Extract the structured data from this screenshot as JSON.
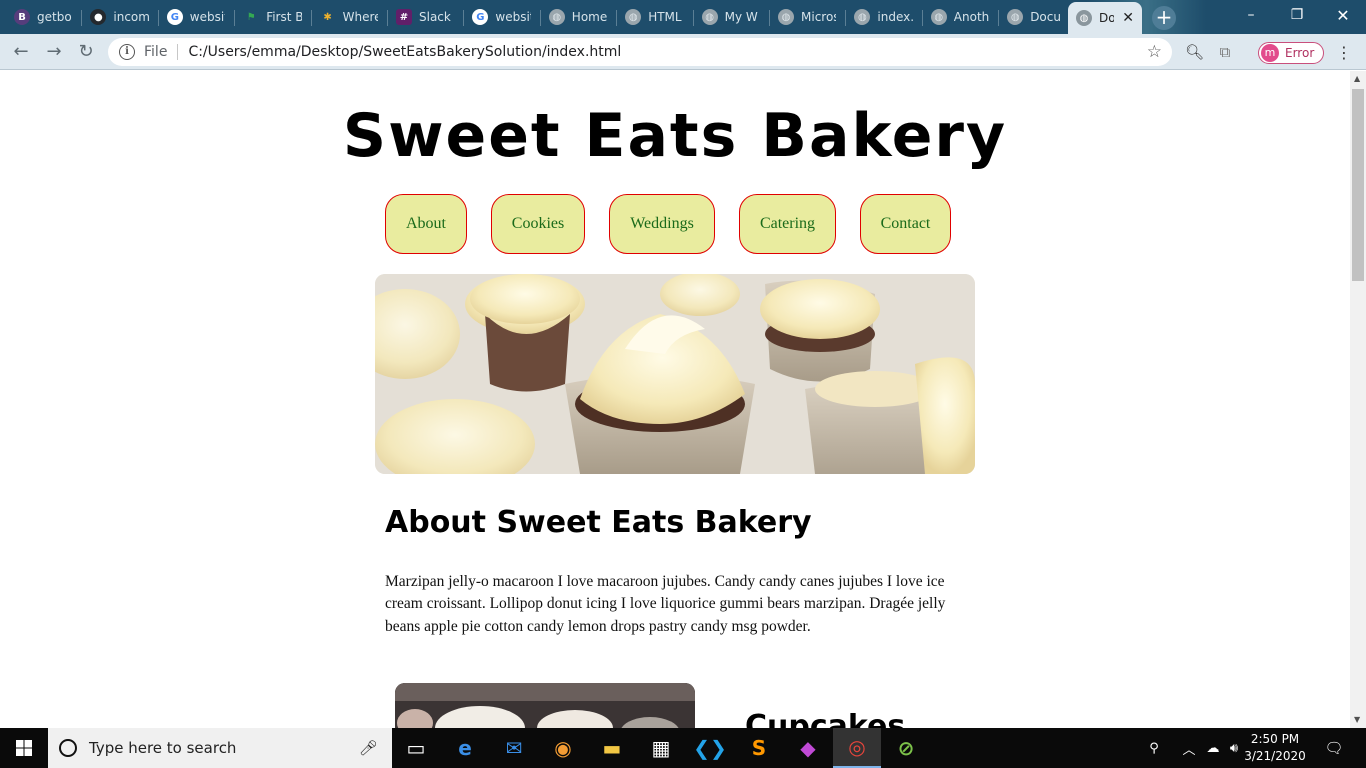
{
  "browser": {
    "tabs": [
      {
        "label": "getbo",
        "icon": "bootstrap-icon",
        "color": "#563d7c"
      },
      {
        "label": "incom",
        "icon": "github-icon",
        "color": "#24292e"
      },
      {
        "label": "websit",
        "icon": "google-icon",
        "color": "#ffffff"
      },
      {
        "label": "First B",
        "icon": "maps-icon",
        "color": "#34a853"
      },
      {
        "label": "Where",
        "icon": "slack-icon",
        "color": "#e01e5a"
      },
      {
        "label": "Slack |",
        "icon": "slack-app-icon",
        "color": "#611f69"
      },
      {
        "label": "websit",
        "icon": "google-icon",
        "color": "#ffffff"
      },
      {
        "label": "Home",
        "icon": "globe-icon",
        "color": "#9aa6ad"
      },
      {
        "label": "HTML",
        "icon": "globe-icon",
        "color": "#9aa6ad"
      },
      {
        "label": "My W",
        "icon": "globe-icon",
        "color": "#9aa6ad"
      },
      {
        "label": "Micros",
        "icon": "globe-icon",
        "color": "#9aa6ad"
      },
      {
        "label": "index.",
        "icon": "globe-icon",
        "color": "#9aa6ad"
      },
      {
        "label": "Anoth",
        "icon": "globe-icon",
        "color": "#9aa6ad"
      },
      {
        "label": "Docu",
        "icon": "globe-icon",
        "color": "#9aa6ad"
      }
    ],
    "active_tab": {
      "label": "Do",
      "close": "✕"
    },
    "new_tab": "+",
    "window_controls": {
      "minimize": "–",
      "restore": "❐",
      "close": "✕"
    },
    "address": {
      "scheme_label": "File",
      "url": "C:/Users/emma/Desktop/SweetEatsBakerySolution/index.html"
    },
    "profile": {
      "initial": "m",
      "status": "Error"
    }
  },
  "page": {
    "title": "Sweet Eats Bakery",
    "nav": [
      "About",
      "Cookies",
      "Weddings",
      "Catering",
      "Contact"
    ],
    "about_heading": "About Sweet Eats Bakery",
    "about_text": "Marzipan jelly-o macaroon I love macaroon jujubes. Candy candy canes jujubes I love ice cream croissant. Lollipop donut icing I love liquorice gummi bears marzipan. Dragée jelly beans apple pie cotton candy lemon drops pastry candy msg powder.",
    "next_heading": "Cupcakes",
    "colors": {
      "pill_fill": "#e9ec9f",
      "pill_border": "#e00000",
      "pill_text": "#1a6a1a"
    }
  },
  "taskbar": {
    "search_placeholder": "Type here to search",
    "apps": [
      "task-view-icon",
      "edge-icon",
      "mail-icon",
      "app-icon",
      "file-explorer-icon",
      "store-icon",
      "vscode-icon",
      "sublime-icon",
      "paint3d-icon",
      "chrome-icon",
      "terminal-icon"
    ],
    "time": "2:50 PM",
    "date": "3/21/2020"
  }
}
